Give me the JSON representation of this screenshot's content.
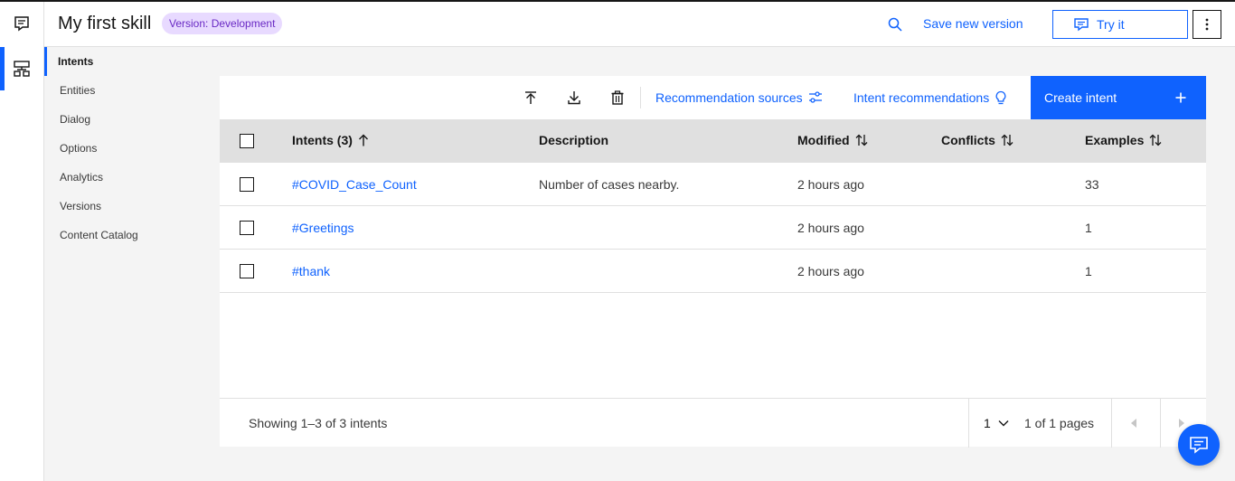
{
  "header": {
    "title": "My first skill",
    "version_tag": "Version: Development",
    "save_version": "Save new version",
    "try_it": "Try it"
  },
  "sidenav": {
    "items": [
      {
        "label": "Intents"
      },
      {
        "label": "Entities"
      },
      {
        "label": "Dialog"
      },
      {
        "label": "Options"
      },
      {
        "label": "Analytics"
      },
      {
        "label": "Versions"
      },
      {
        "label": "Content Catalog"
      }
    ]
  },
  "toolbar": {
    "recommendation_sources": "Recommendation sources",
    "intent_recommendations": "Intent recommendations",
    "create_intent": "Create intent"
  },
  "table": {
    "headers": {
      "intents": "Intents (3)",
      "description": "Description",
      "modified": "Modified",
      "conflicts": "Conflicts",
      "examples": "Examples"
    },
    "rows": [
      {
        "name": "#COVID_Case_Count",
        "description": "Number of cases nearby.",
        "modified": "2 hours ago",
        "conflicts": "",
        "examples": "33"
      },
      {
        "name": "#Greetings",
        "description": "",
        "modified": "2 hours ago",
        "conflicts": "",
        "examples": "1"
      },
      {
        "name": "#thank",
        "description": "",
        "modified": "2 hours ago",
        "conflicts": "",
        "examples": "1"
      }
    ]
  },
  "pagination": {
    "showing": "Showing 1–3 of 3 intents",
    "page": "1",
    "of_pages": "1 of 1 pages"
  },
  "colors": {
    "accent": "#0f62fe",
    "tag_bg": "#e8daff",
    "tag_text": "#6929c4"
  },
  "icons": [
    "chat-icon",
    "skill-tree-icon",
    "search-icon",
    "chat-bubble-icon",
    "overflow-menu-icon",
    "upload-icon",
    "download-icon",
    "trash-icon",
    "settings-adjust-icon",
    "lightbulb-icon",
    "plus-icon",
    "arrow-up-icon",
    "sort-icon",
    "chevron-down-icon",
    "caret-left-icon",
    "caret-right-icon"
  ]
}
